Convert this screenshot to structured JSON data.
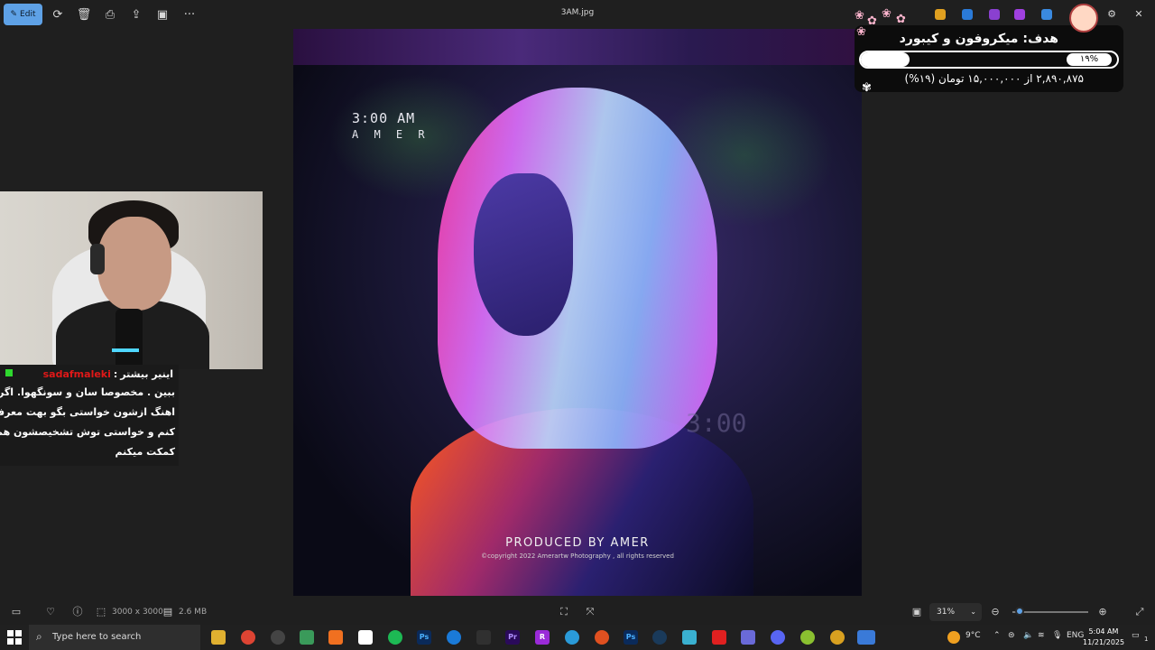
{
  "toolbar": {
    "edit_label": "Edit",
    "file_title": "3AM.jpg",
    "more_label": "···"
  },
  "photo": {
    "time_text": "3:00 AM",
    "artist_text": "A M E R",
    "produced_text": "PRODUCED BY AMER",
    "copyright_text": "©copyright 2022 Amerartw Photography , all rights reserved",
    "clock_text": "3:00"
  },
  "chat": {
    "username": "sadafmaleki",
    "separator": ":",
    "title_label": "اینیر بیشتر",
    "lines": [
      "ببین . مخصوصا سان و سونگهوا. اگر",
      "اهنگ ازشون خواستی بگو بهت معرفی",
      "کنم و خواستی توش تشخیصشون هم",
      "کمکت میکنم"
    ]
  },
  "goal": {
    "title": "هدف: میکروفون و کیبورد",
    "percent_label": "۱۹%",
    "progress_fraction": 0.19,
    "amount_text": "۲,۸۹۰,۸۷۵ از ۱۵,۰۰۰,۰۰۰ تومان (۱۹%)"
  },
  "statusbar": {
    "dimensions": "3000 x 3000",
    "file_size": "2.6 MB",
    "zoom": "31%",
    "zoom_fraction": 0.04
  },
  "taskbar": {
    "search_placeholder": "Type here to search",
    "weather": "9°C",
    "language": "ENG",
    "time": "5:04 AM",
    "date": "11/21/2025",
    "notification_count": "1"
  },
  "colors": {
    "accent": "#5ea1e6",
    "chat_username": "#e01818",
    "badge_green": "#2ed82e"
  }
}
